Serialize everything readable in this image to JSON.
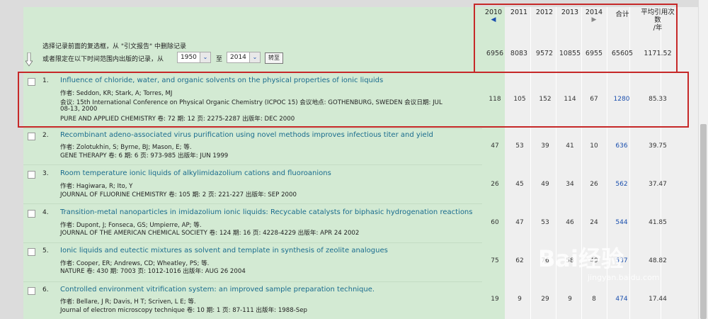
{
  "header": {
    "years": [
      {
        "label": "2010",
        "arrow": "◀"
      },
      {
        "label": "2011",
        "arrow": ""
      },
      {
        "label": "2012",
        "arrow": ""
      },
      {
        "label": "2013",
        "arrow": ""
      },
      {
        "label": "2014",
        "arrow": "▶"
      }
    ],
    "total_label": "合计",
    "avg_label_1": "平均引用次",
    "avg_label_2": "数",
    "avg_label_3": "/年",
    "totals": [
      "6956",
      "8083",
      "9572",
      "10855",
      "6955",
      "65605",
      "1171.52"
    ]
  },
  "filter": {
    "instruction_1": "选择记录前面的复选框，从 \"引文报告\" 中删除记录",
    "instruction_2": "或者限定在以下时间范围内出版的记录，从",
    "from_year": "1950",
    "to_label": "至",
    "to_year": "2014",
    "go_label": "转至"
  },
  "records": [
    {
      "num": "1.",
      "title": "Influence of chloride, water, and organic solvents on the physical properties of ionic liquids",
      "authors": "作者: Seddon, KR; Stark, A; Torres, MJ",
      "extra": "会议: 15th International Conference on Physical Organic Chemistry (ICPOC 15) 会议地点: GOTHENBURG, SWEDEN 会议日期: JUL",
      "extra2": "08-13, 2000",
      "journal": "PURE AND APPLIED CHEMISTRY  卷: 72  期: 12  页: 2275-2287  出版年: DEC 2000",
      "vals": [
        "118",
        "105",
        "152",
        "114",
        "67",
        "1280",
        "85.33"
      ]
    },
    {
      "num": "2.",
      "title": "Recombinant adeno-associated virus purification using novel methods improves infectious titer and yield",
      "authors": "作者: Zolotukhin, S; Byrne, BJ; Mason, E; 等.",
      "journal": "GENE THERAPY  卷: 6  期: 6  页: 973-985  出版年: JUN 1999",
      "vals": [
        "47",
        "53",
        "39",
        "41",
        "10",
        "636",
        "39.75"
      ]
    },
    {
      "num": "3.",
      "title": "Room temperature ionic liquids of alkylimidazolium cations and fluoroanions",
      "authors": "作者: Hagiwara, R; Ito, Y",
      "journal": "JOURNAL OF FLUORINE CHEMISTRY  卷: 105  期: 2  页: 221-227  出版年: SEP 2000",
      "vals": [
        "26",
        "45",
        "49",
        "34",
        "26",
        "562",
        "37.47"
      ]
    },
    {
      "num": "4.",
      "title": "Transition-metal nanoparticles in imidazolium ionic liquids: Recycable catalysts for biphasic hydrogenation reactions",
      "authors": "作者: Dupont, J; Fonseca, GS; Umpierre, AP; 等.",
      "journal": "JOURNAL OF THE AMERICAN CHEMICAL SOCIETY  卷: 124  期: 16  页: 4228-4229  出版年: APR 24 2002",
      "vals": [
        "60",
        "47",
        "53",
        "46",
        "24",
        "544",
        "41.85"
      ]
    },
    {
      "num": "5.",
      "title": "Ionic liquids and eutectic mixtures as solvent and template in synthesis of zeolite analogues",
      "authors": "作者: Cooper, ER; Andrews, CD; Wheatley, PS; 等.",
      "journal": "NATURE  卷: 430  期: 7003  页: 1012-1016  出版年: AUG 26 2004",
      "vals": [
        "75",
        "62",
        "76",
        "58",
        "49",
        "537",
        "48.82"
      ]
    },
    {
      "num": "6.",
      "title": "Controlled environment vitrification system: an improved sample preparation technique.",
      "authors": "作者: Bellare, J R; Davis, H T; Scriven, L E; 等.",
      "journal": "Journal of electron microscopy technique  卷: 10  期: 1  页: 87-111  出版年: 1988-Sep",
      "vals": [
        "19",
        "9",
        "29",
        "9",
        "8",
        "474",
        "17.44"
      ]
    }
  ],
  "watermark": {
    "brand": "Bai经验",
    "site": "jingyan.baidu.com"
  },
  "colors": {
    "link": "#1a6c8e",
    "highlight": "#c62828",
    "panel": "#d3ead3"
  }
}
